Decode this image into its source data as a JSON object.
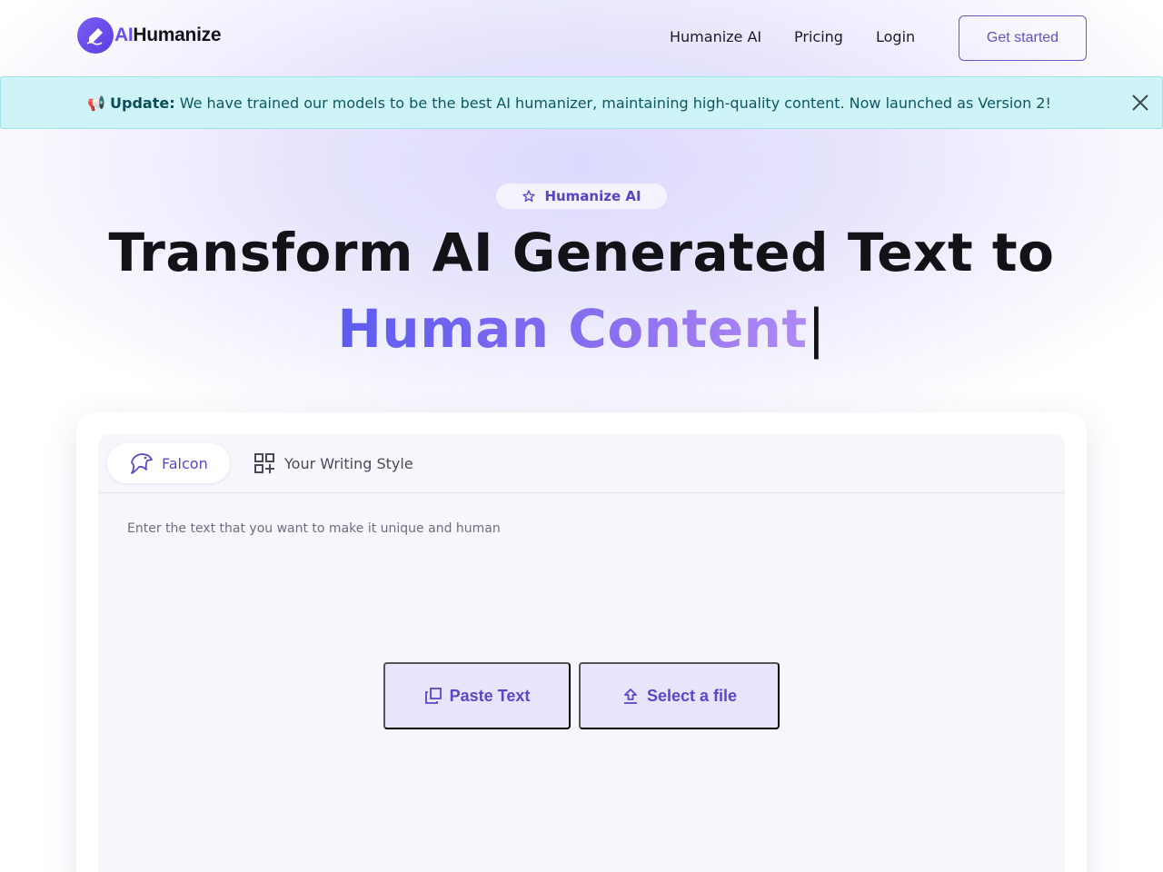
{
  "brand": {
    "logo_ai": "AI",
    "logo_rest": "Humanize"
  },
  "nav": {
    "humanize": "Humanize AI",
    "pricing": "Pricing",
    "login": "Login",
    "cta": "Get started"
  },
  "banner": {
    "icon": "📢",
    "label": "Update:",
    "message": "We have trained our models to be the best AI humanizer, maintaining high-quality content. Now launched as Version 2!"
  },
  "hero": {
    "pill": "Humanize AI",
    "line1": "Transform AI Generated Text to",
    "line2": "Human Content",
    "cursor": "|"
  },
  "editor": {
    "tabs": [
      {
        "label": "Falcon",
        "icon": "falcon-icon",
        "active": true
      },
      {
        "label": "Your Writing Style",
        "icon": "grid-plus-icon",
        "active": false
      }
    ],
    "placeholder": "Enter the text that you want to make it unique and human",
    "paste_label": "Paste Text",
    "select_label": "Select a file"
  },
  "colors": {
    "accent": "#6a4ff0",
    "banner_bg": "#cef4f8",
    "banner_text": "#0c5763",
    "gradient_start": "#5b5cf0",
    "gradient_end": "#b08af5"
  }
}
